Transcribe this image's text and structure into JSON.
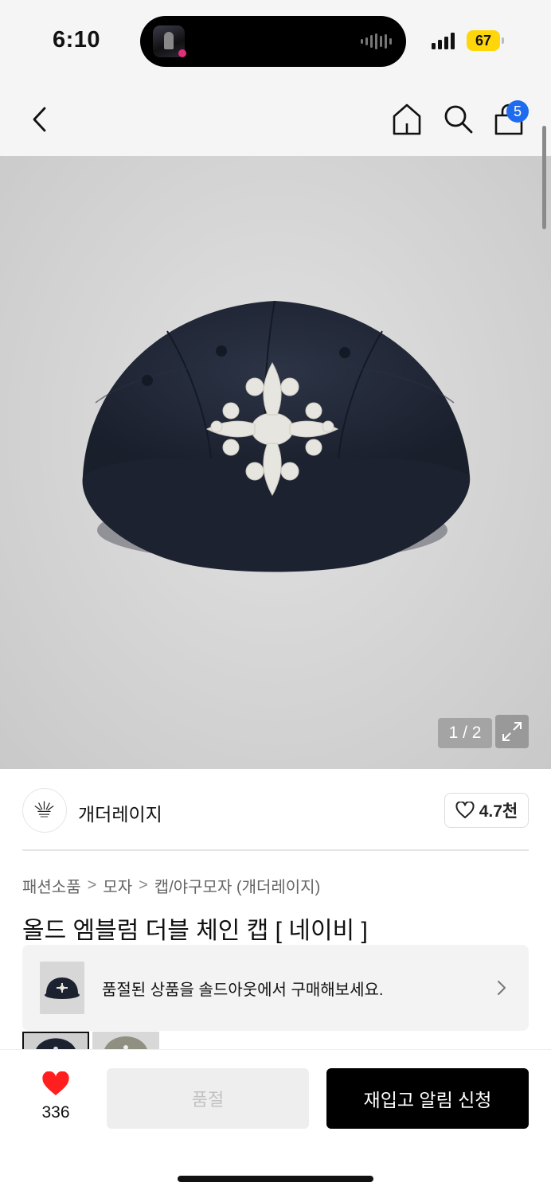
{
  "status_bar": {
    "time": "6:10",
    "battery": "67",
    "colors": {
      "battery": "#ffd60a"
    }
  },
  "header": {
    "cart_badge": "5",
    "icons": [
      "back-icon",
      "home-icon",
      "search-icon",
      "cart-icon"
    ],
    "colors": {
      "badge": "#1f6bf0"
    }
  },
  "gallery": {
    "pager": "1 / 2",
    "image": "navy-cap-with-white-emblem"
  },
  "brand": {
    "name": "개더레이지",
    "likes": "4.7천"
  },
  "breadcrumb": {
    "items": [
      "패션소품",
      "모자",
      "캡/야구모자 (개더레이지)"
    ],
    "separator": ">"
  },
  "product": {
    "title": "올드 엠블럼 더블 체인 캡 [ 네이비 ]"
  },
  "soldout_banner": {
    "text": "품절된 상품을 솔드아웃에서 구매해보세요."
  },
  "bottom_bar": {
    "like_count": "336",
    "soldout_label": "품절",
    "restock_label": "재입고 알림 신청",
    "colors": {
      "heart": "#ff1f1f",
      "primary": "#000000"
    }
  }
}
